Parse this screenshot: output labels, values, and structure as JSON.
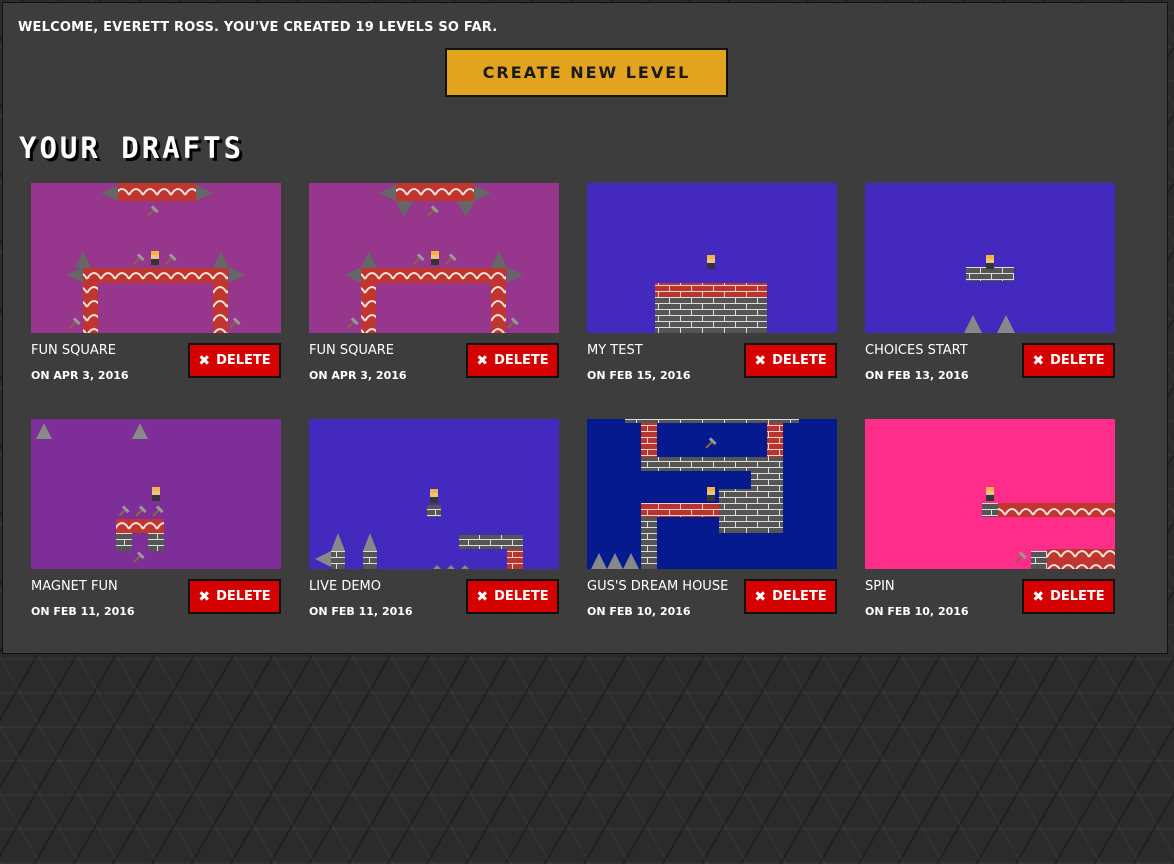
{
  "welcome_text": "WELCOME, EVERETT ROSS. YOU'VE CREATED 19 LEVELS SO FAR.",
  "create_button_label": "CREATE NEW LEVEL",
  "drafts_heading": "YOUR DRAFTS",
  "delete_icon": "x-icon",
  "colors": {
    "accent": "#e2a41f",
    "delete": "#d50000",
    "panel": "#3d3d3d"
  },
  "drafts": [
    {
      "name": "FUN SQUARE",
      "date": "ON APR 3, 2016",
      "delete_label": "DELETE",
      "bg": "#96368c"
    },
    {
      "name": "FUN SQUARE",
      "date": "ON APR 3, 2016",
      "delete_label": "DELETE",
      "bg": "#96368c"
    },
    {
      "name": "MY TEST",
      "date": "ON FEB 15, 2016",
      "delete_label": "DELETE",
      "bg": "#4329bd"
    },
    {
      "name": "CHOICES START",
      "date": "ON FEB 13, 2016",
      "delete_label": "DELETE",
      "bg": "#4329bd"
    },
    {
      "name": "MAGNET FUN",
      "date": "ON FEB 11, 2016",
      "delete_label": "DELETE",
      "bg": "#7d2e98"
    },
    {
      "name": "LIVE DEMO",
      "date": "ON FEB 11, 2016",
      "delete_label": "DELETE",
      "bg": "#4329bd"
    },
    {
      "name": "GUS'S DREAM HOUSE",
      "date": "ON FEB 10, 2016",
      "delete_label": "DELETE",
      "bg": "#051a8f"
    },
    {
      "name": "SPIN",
      "date": "ON FEB 10, 2016",
      "delete_label": "DELETE",
      "bg": "#ff2d8a"
    }
  ]
}
